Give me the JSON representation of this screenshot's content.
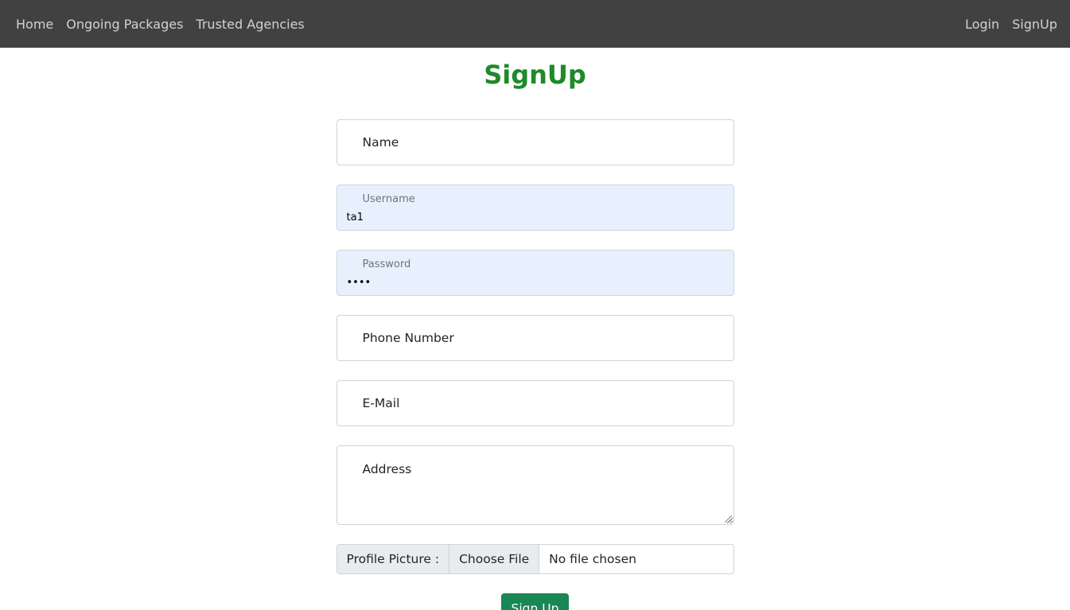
{
  "navbar": {
    "left_links": [
      "Home",
      "Ongoing Packages",
      "Trusted Agencies"
    ],
    "right_links": [
      "Login",
      "SignUp"
    ]
  },
  "page": {
    "title": "SignUp"
  },
  "form": {
    "name_label": "Name",
    "username_label": "Username",
    "username_value": "ta1",
    "password_label": "Password",
    "password_value": "ta12",
    "phone_label": "Phone Number",
    "email_label": "E-Mail",
    "address_label": "Address",
    "profile_picture_label": "Profile Picture :",
    "choose_file_label": "Choose File",
    "no_file_text": "No file chosen",
    "submit_label": "Sign Up"
  },
  "colors": {
    "navbar_bg": "#414141",
    "title_green": "#1e8a2a",
    "autofill_bg": "#e8f0fe",
    "submit_bg": "#198754"
  }
}
